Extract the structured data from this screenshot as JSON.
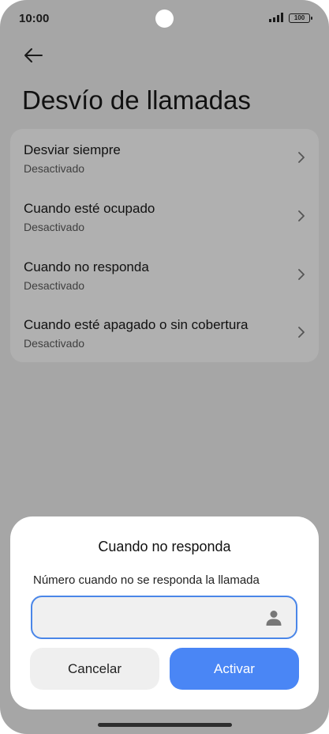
{
  "status_bar": {
    "time": "10:00",
    "battery": "100"
  },
  "header": {
    "back_icon": "arrow-left-icon",
    "title": "Desvío de llamadas"
  },
  "settings": {
    "items": [
      {
        "label": "Desviar siempre",
        "value": "Desactivado"
      },
      {
        "label": "Cuando esté ocupado",
        "value": "Desactivado"
      },
      {
        "label": "Cuando no responda",
        "value": "Desactivado"
      },
      {
        "label": "Cuando esté apagado o sin cobertura",
        "value": "Desactivado"
      }
    ],
    "chevron_icon": "chevron-right-icon"
  },
  "dialog": {
    "title": "Cuando no responda",
    "label": "Número cuando no se responda la llamada",
    "input_value": "",
    "contact_icon": "person-icon",
    "cancel_label": "Cancelar",
    "activate_label": "Activar"
  },
  "colors": {
    "scrim": "#a6a6a6",
    "card": "#b0b0b0",
    "accent": "#4a86f5",
    "input_border": "#4a86e8"
  }
}
